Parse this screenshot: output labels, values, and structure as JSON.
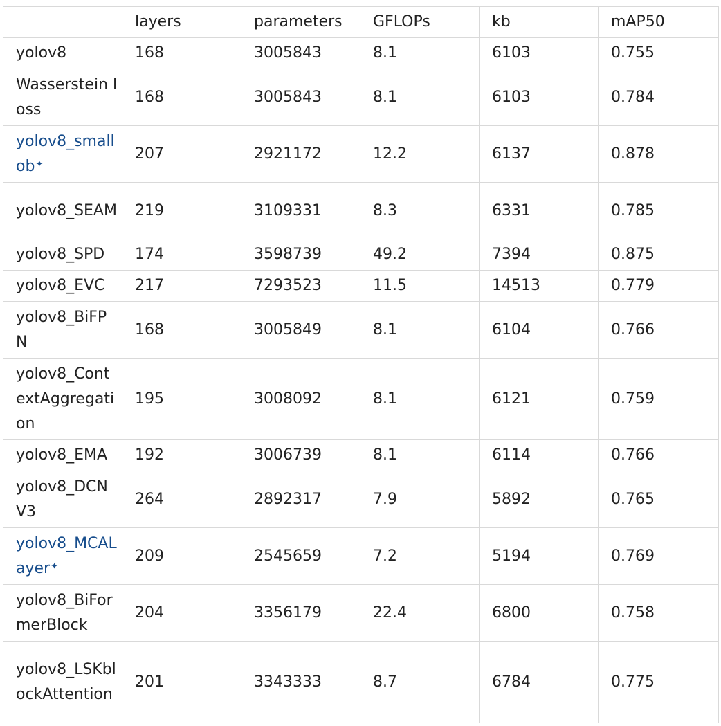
{
  "table": {
    "headers": [
      "",
      "layers",
      "parameters",
      "GFLOPs",
      "kb",
      "mAP50"
    ],
    "rows": [
      {
        "name": "yolov8",
        "layers": "168",
        "parameters": "3005843",
        "gflops": "8.1",
        "kb": "6103",
        "map50": "0.755",
        "link": false
      },
      {
        "name": "Wasserstein loss",
        "layers": "168",
        "parameters": "3005843",
        "gflops": "8.1",
        "kb": "6103",
        "map50": "0.784",
        "link": false
      },
      {
        "name": "yolov8_smallob",
        "layers": "207",
        "parameters": "2921172",
        "gflops": "12.2",
        "kb": "6137",
        "map50": "0.878",
        "link": true,
        "link_icon": "sparkle-icon"
      },
      {
        "name": "yolov8_SEAM",
        "layers": "219",
        "parameters": "3109331",
        "gflops": "8.3",
        "kb": "6331",
        "map50": "0.785",
        "link": false
      },
      {
        "name": "yolov8_SPD",
        "layers": "174",
        "parameters": "3598739",
        "gflops": "49.2",
        "kb": "7394",
        "map50": "0.875",
        "link": false
      },
      {
        "name": "yolov8_EVC",
        "layers": "217",
        "parameters": "7293523",
        "gflops": "11.5",
        "kb": "14513",
        "map50": "0.779",
        "link": false
      },
      {
        "name": "yolov8_BiFPN",
        "layers": "168",
        "parameters": "3005849",
        "gflops": "8.1",
        "kb": "6104",
        "map50": "0.766",
        "link": false
      },
      {
        "name": "yolov8_ContextAggregation",
        "layers": "195",
        "parameters": "3008092",
        "gflops": "8.1",
        "kb": "6121",
        "map50": "0.759",
        "link": false
      },
      {
        "name": "yolov8_EMA",
        "layers": "192",
        "parameters": "3006739",
        "gflops": "8.1",
        "kb": "6114",
        "map50": "0.766",
        "link": false
      },
      {
        "name": "yolov8_DCNV3",
        "layers": "264",
        "parameters": "2892317",
        "gflops": "7.9",
        "kb": "5892",
        "map50": "0.765",
        "link": false
      },
      {
        "name": "yolov8_MCALayer",
        "layers": "209",
        "parameters": "2545659",
        "gflops": "7.2",
        "kb": "5194",
        "map50": "0.769",
        "link": true,
        "link_icon": "sparkle-icon"
      },
      {
        "name": "yolov8_BiFormerBlock",
        "layers": "204",
        "parameters": "3356179",
        "gflops": "22.4",
        "kb": "6800",
        "map50": "0.758",
        "link": false
      },
      {
        "name": "yolov8_LSKblockAttention",
        "layers": "201",
        "parameters": "3343333",
        "gflops": "8.7",
        "kb": "6784",
        "map50": "0.775",
        "link": false
      }
    ]
  },
  "colors": {
    "link": "#174d8c",
    "border": "#d9d9d9",
    "text": "#222222"
  }
}
